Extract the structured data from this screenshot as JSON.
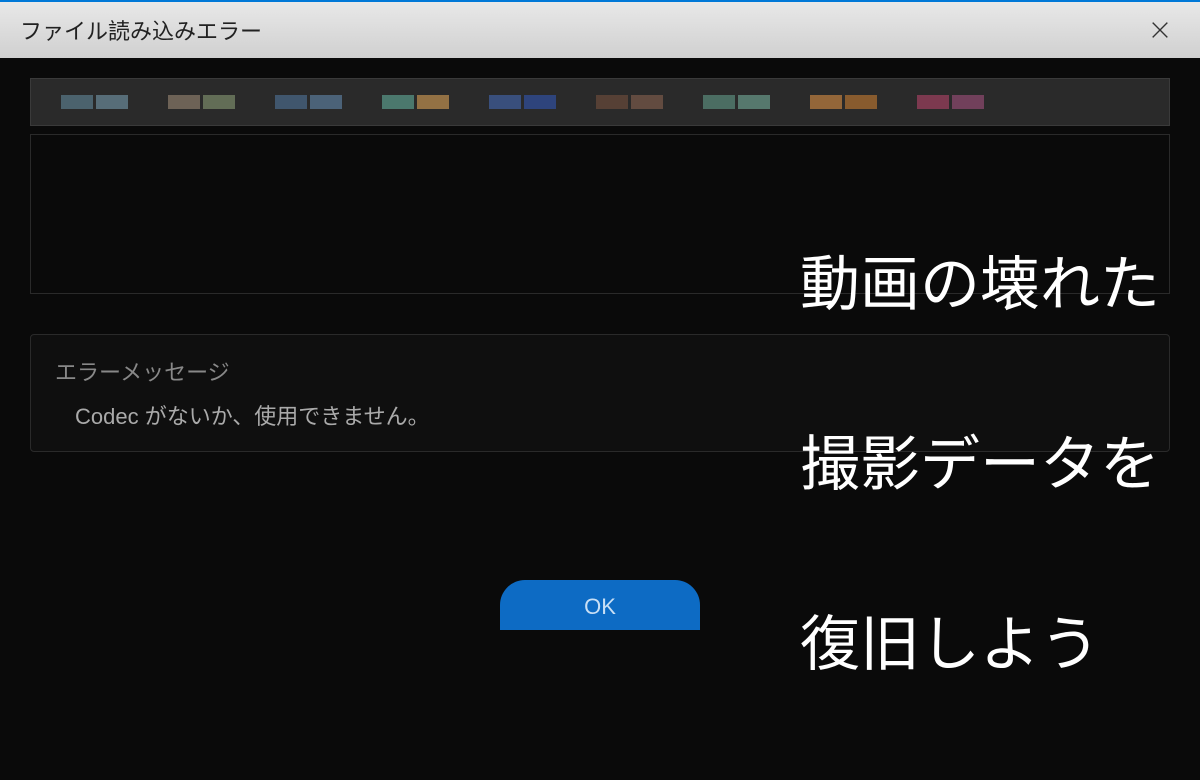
{
  "titleBar": {
    "title": "ファイル読み込みエラー"
  },
  "thumbnails": [
    {
      "colors": [
        "#5a7a8a",
        "#6b8a9a"
      ]
    },
    {
      "colors": [
        "#8a7a6a",
        "#7a8a6a"
      ]
    },
    {
      "colors": [
        "#4a6a8a",
        "#5a7a9a"
      ]
    },
    {
      "colors": [
        "#5a9a8a",
        "#c09050"
      ]
    },
    {
      "colors": [
        "#4060a0",
        "#3050a0"
      ]
    },
    {
      "colors": [
        "#6a4a3a",
        "#7a5a4a"
      ]
    },
    {
      "colors": [
        "#5a8a7a",
        "#6a9a8a"
      ]
    },
    {
      "colors": [
        "#c08040",
        "#b07030"
      ]
    },
    {
      "colors": [
        "#a04060",
        "#904a70"
      ]
    }
  ],
  "errorSection": {
    "label": "エラーメッセージ",
    "message": "Codec がないか、使用できません。"
  },
  "buttons": {
    "ok": "OK"
  },
  "overlay": {
    "line1": "動画の壊れた",
    "line2": "撮影データを",
    "line3": "復旧しよう"
  }
}
